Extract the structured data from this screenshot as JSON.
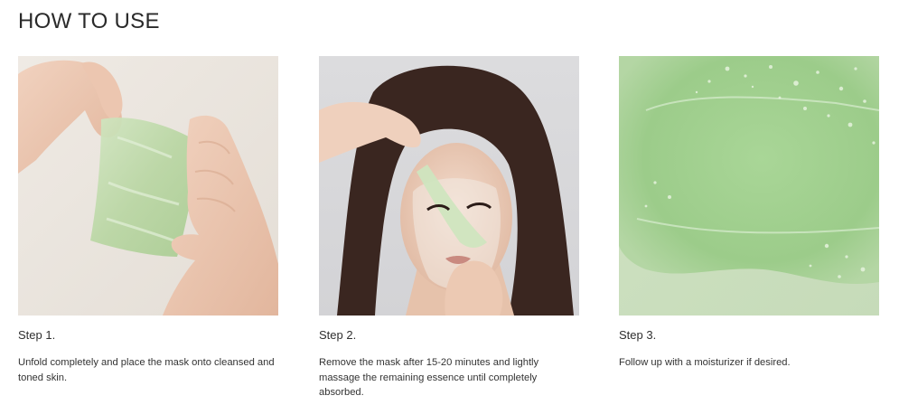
{
  "section": {
    "title": "HOW TO USE"
  },
  "steps": [
    {
      "label": "Step 1.",
      "description": "Unfold completely and place the mask onto cleansed and toned skin.",
      "image_icon": "hands-unfolding-mask-image"
    },
    {
      "label": "Step 2.",
      "description": "Remove the mask after 15-20 minutes and lightly massage the remaining essence until completely absorbed.",
      "image_icon": "woman-removing-mask-image"
    },
    {
      "label": "Step 3.",
      "description": "Follow up with a moisturizer if desired.",
      "image_icon": "green-essence-texture-image"
    }
  ],
  "colors": {
    "title": "#2a2a2a",
    "text": "#333333",
    "mask_green": "#bcd9a8",
    "essence_green": "#9fcf8f",
    "photo_bg_1": "#e9e4de",
    "photo_bg_2": "#d9d9db"
  }
}
